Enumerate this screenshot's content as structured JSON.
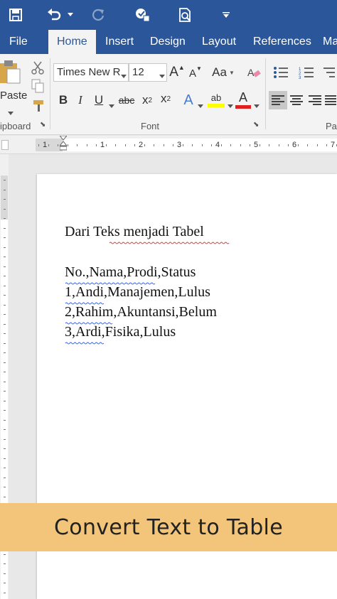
{
  "quick_access": {
    "save_icon": "save-icon",
    "undo_icon": "undo-icon",
    "redo_icon": "redo-icon",
    "touch_icon": "touch-mode-icon",
    "preview_icon": "print-preview-icon",
    "customize_icon": "customize-qat-icon"
  },
  "tabs": [
    {
      "label": "File"
    },
    {
      "label": "Home",
      "active": true
    },
    {
      "label": "Insert"
    },
    {
      "label": "Design"
    },
    {
      "label": "Layout"
    },
    {
      "label": "References"
    },
    {
      "label": "Ma"
    }
  ],
  "ribbon": {
    "clipboard": {
      "paste_label": "Paste",
      "group_label": "ipboard"
    },
    "font": {
      "font_name": "Times New R",
      "font_size": "12",
      "group_label": "Font",
      "bold": "B",
      "italic": "I",
      "underline": "U",
      "strike": "abc",
      "subscript": "x",
      "sub_mark": "2",
      "superscript": "x",
      "sup_mark": "2",
      "grow": "A",
      "shrink": "A",
      "case": "Aa",
      "effects": "A",
      "highlight": "ab",
      "color": "A"
    },
    "paragraph": {
      "group_label": "Pa"
    }
  },
  "ruler": {
    "numbers": [
      "1",
      "1",
      "2",
      "3",
      "4",
      "5",
      "6",
      "7"
    ]
  },
  "document": {
    "title": "Dari Teks menjadi Tabel",
    "lines": [
      "No.,Nama,Prodi,Status",
      "1,Andi,Manajemen,Lulus",
      "2,Rahim,Akuntansi,Belum",
      "3,Ardi,Fisika,Lulus"
    ]
  },
  "banner": {
    "text": "Convert Text to Table"
  },
  "colors": {
    "accent": "#2b579a",
    "ribbon_bg": "#f3f3f3",
    "banner_bg": "#f3c57b",
    "highlight_yellow": "#ffff00",
    "font_color_red": "#e02020",
    "spell_squiggle": "#d13b3b"
  }
}
